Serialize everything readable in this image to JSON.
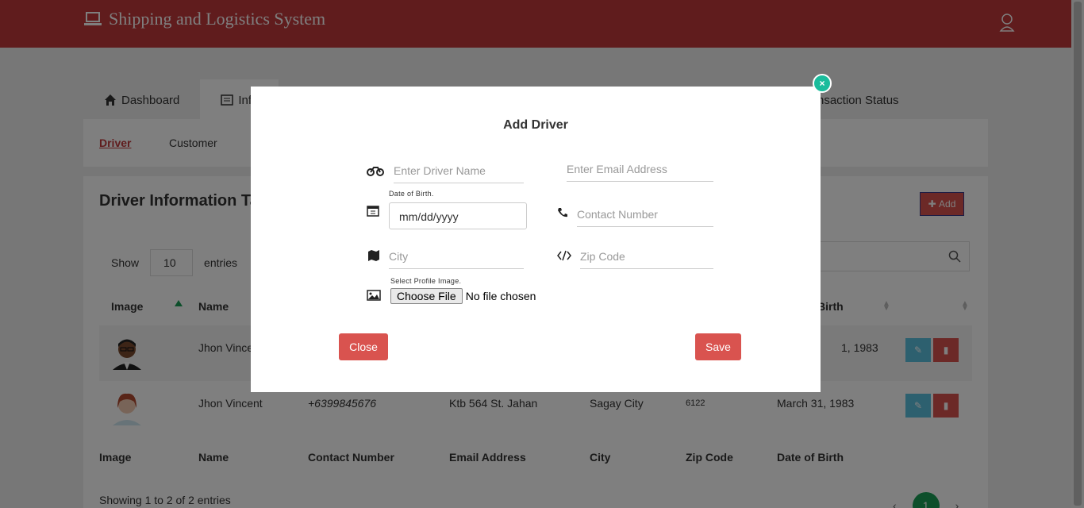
{
  "header": {
    "brand": "Shipping and Logistics System"
  },
  "tabs": [
    {
      "label": "Dashboard"
    },
    {
      "label": "Info"
    },
    {
      "label": "nsaction Status"
    }
  ],
  "subnav": {
    "driver": "Driver",
    "customer": "Customer"
  },
  "panel": {
    "title": "Driver Information Ta",
    "add_label": "Add",
    "show_label": "Show",
    "entries_value": "10",
    "entries_label": "entries"
  },
  "table": {
    "headers": {
      "image": "Image",
      "name": "Name",
      "dob_partial": "Birth"
    },
    "footer_headers": [
      "Image",
      "Name",
      "Contact Number",
      "Email Address",
      "City",
      "Zip Code",
      "Date of Birth"
    ],
    "rows": [
      {
        "name": "Jhon Vince",
        "dob": "1, 1983"
      },
      {
        "name": "Jhon Vincent",
        "contact": "+6399845676",
        "email": "Ktb 564 St. Jahan",
        "city": "Sagay City",
        "zip": "6122",
        "dob": "March 31, 1983"
      }
    ],
    "info": "Showing 1 to 2 of 2 entries",
    "current_page": "1",
    "prev": "‹",
    "next": "›"
  },
  "modal": {
    "title": "Add Driver",
    "close_x": "×",
    "driver_name_placeholder": "Enter Driver Name",
    "email_placeholder": "Enter Email Address",
    "dob_label": "Date of Birth.",
    "dob_value": "mm/dd/yyyy",
    "contact_placeholder": "Contact Number",
    "city_placeholder": "City",
    "zip_placeholder": "Zip Code",
    "image_label": "Select Profile Image.",
    "choose_file": "Choose File",
    "no_file": "No file chosen",
    "close_button": "Close",
    "save_button": "Save"
  },
  "colors": {
    "brand": "#c0393b",
    "accent": "#1a9f56",
    "danger": "#d9534f",
    "info": "#5bc0de"
  }
}
